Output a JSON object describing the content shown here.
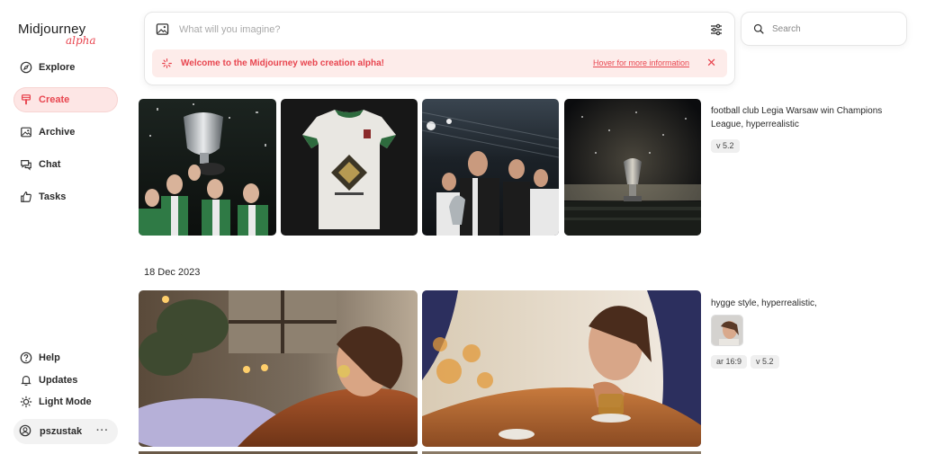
{
  "brand": {
    "name": "Midjourney",
    "tag": "alpha"
  },
  "nav": [
    {
      "label": "Explore",
      "icon": "compass-icon"
    },
    {
      "label": "Create",
      "icon": "brush-icon",
      "active": true
    },
    {
      "label": "Archive",
      "icon": "image-icon"
    },
    {
      "label": "Chat",
      "icon": "chat-icon"
    },
    {
      "label": "Tasks",
      "icon": "thumbs-up-icon"
    }
  ],
  "footer_nav": [
    {
      "label": "Help",
      "icon": "help-icon"
    },
    {
      "label": "Updates",
      "icon": "bell-icon"
    },
    {
      "label": "Light Mode",
      "icon": "sun-icon"
    }
  ],
  "user": {
    "name": "pszustak",
    "more": "···"
  },
  "prompt": {
    "placeholder": "What will you imagine?"
  },
  "banner": {
    "message": "Welcome to the Midjourney web creation alpha!",
    "link": "Hover for more information",
    "close": "✕"
  },
  "search": {
    "placeholder": "Search"
  },
  "jobs": [
    {
      "caption": "football club Legia Warsaw win Champions League, hyperrealistic",
      "tags": [
        "v 5.2"
      ]
    },
    {
      "date": "18 Dec 2023",
      "caption": "hygge style, hyperrealistic,",
      "tags": [
        "ar 16:9",
        "v 5.2"
      ]
    }
  ],
  "colors": {
    "accent": "#e8454f",
    "accent_bg": "#fdecea"
  }
}
